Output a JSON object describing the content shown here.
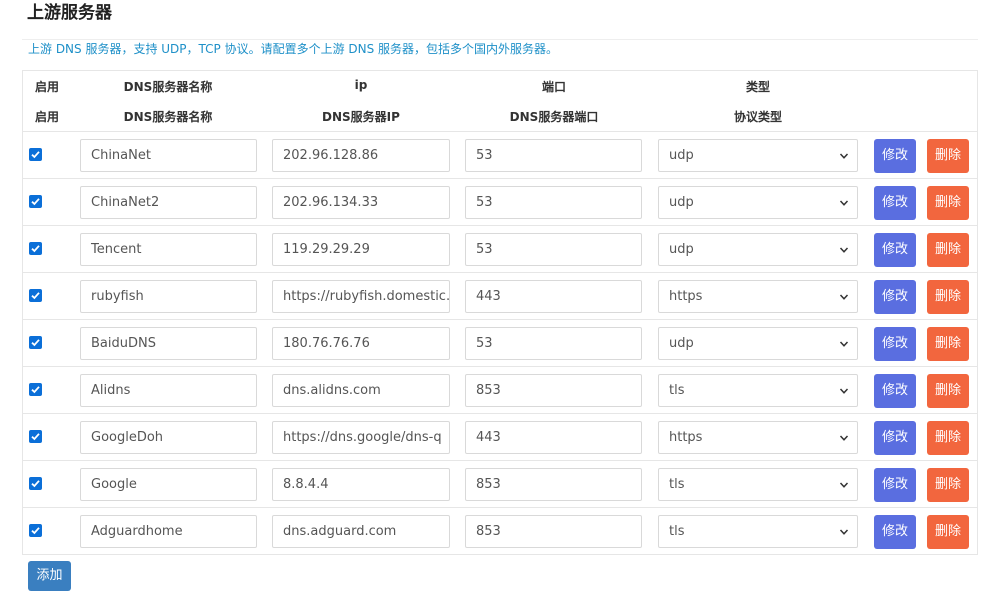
{
  "page": {
    "title": "上游服务器"
  },
  "description": "上游 DNS 服务器，支持 UDP，TCP 协议。请配置多个上游 DNS 服务器，包括多个国内外服务器。",
  "header_row_1": {
    "enabled": "启用",
    "name": "DNS服务器名称",
    "ip": "ip",
    "port": "端口",
    "type": "类型"
  },
  "header_row_2": {
    "enabled": "启用",
    "name": "DNS服务器名称",
    "ip": "DNS服务器IP",
    "port": "DNS服务器端口",
    "type": "协议类型"
  },
  "actions": {
    "edit_label": "修改",
    "delete_label": "删除",
    "add_label": "添加"
  },
  "servers": [
    {
      "enabled": true,
      "name": "ChinaNet",
      "ip": "202.96.128.86",
      "port": "53",
      "protocol": "udp"
    },
    {
      "enabled": true,
      "name": "ChinaNet2",
      "ip": "202.96.134.33",
      "port": "53",
      "protocol": "udp"
    },
    {
      "enabled": true,
      "name": "Tencent",
      "ip": "119.29.29.29",
      "port": "53",
      "protocol": "udp"
    },
    {
      "enabled": true,
      "name": "rubyfish",
      "ip": "https://rubyfish.domestic.",
      "port": "443",
      "protocol": "https"
    },
    {
      "enabled": true,
      "name": "BaiduDNS",
      "ip": "180.76.76.76",
      "port": "53",
      "protocol": "udp"
    },
    {
      "enabled": true,
      "name": "Alidns",
      "ip": "dns.alidns.com",
      "port": "853",
      "protocol": "tls"
    },
    {
      "enabled": true,
      "name": "GoogleDoh",
      "ip": "https://dns.google/dns-q",
      "port": "443",
      "protocol": "https"
    },
    {
      "enabled": true,
      "name": "Google",
      "ip": "8.8.4.4",
      "port": "853",
      "protocol": "tls"
    },
    {
      "enabled": true,
      "name": "Adguardhome",
      "ip": "dns.adguard.com",
      "port": "853",
      "protocol": "tls"
    }
  ],
  "colors": {
    "edit_button": "#5a6ee0",
    "delete_button": "#f2663e",
    "add_button": "#3a7fc0",
    "description_text": "#1e90c8",
    "checkbox": "#0b6fd8"
  }
}
